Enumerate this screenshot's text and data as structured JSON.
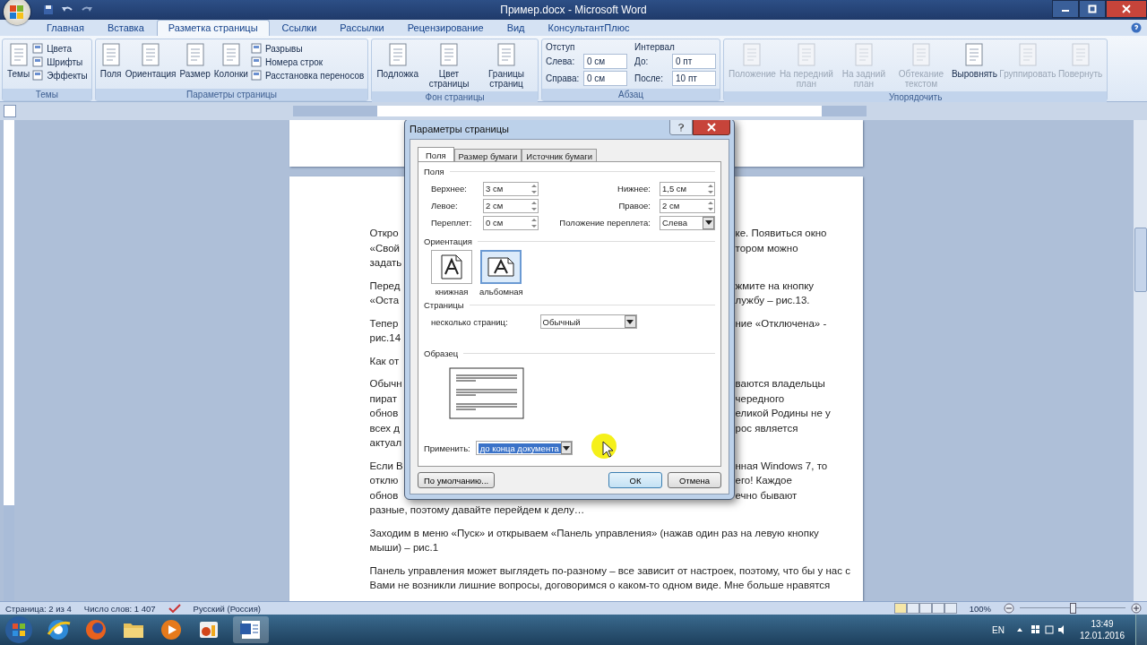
{
  "window": {
    "title": "Пример.docx - Microsoft Word"
  },
  "tabs": [
    {
      "label": "Главная",
      "selected": false
    },
    {
      "label": "Вставка",
      "selected": false
    },
    {
      "label": "Разметка страницы",
      "selected": true
    },
    {
      "label": "Ссылки",
      "selected": false
    },
    {
      "label": "Рассылки",
      "selected": false
    },
    {
      "label": "Рецензирование",
      "selected": false
    },
    {
      "label": "Вид",
      "selected": false
    },
    {
      "label": "КонсультантПлюс",
      "selected": false
    }
  ],
  "ribbon": [
    {
      "title": "Темы",
      "items": [
        {
          "kind": "big",
          "label": "Темы",
          "disabled": false
        },
        {
          "kind": "small",
          "label": "Цвета"
        },
        {
          "kind": "small",
          "label": "Шрифты"
        },
        {
          "kind": "small",
          "label": "Эффекты"
        }
      ]
    },
    {
      "title": "Параметры страницы",
      "items": [
        {
          "kind": "big",
          "label": "Поля",
          "disabled": false
        },
        {
          "kind": "big",
          "label": "Ориентация",
          "disabled": false
        },
        {
          "kind": "big",
          "label": "Размер",
          "disabled": false
        },
        {
          "kind": "big",
          "label": "Колонки",
          "disabled": false
        },
        {
          "kind": "small",
          "label": "Разрывы"
        },
        {
          "kind": "small",
          "label": "Номера строк"
        },
        {
          "kind": "small",
          "label": "Расстановка переносов"
        }
      ]
    },
    {
      "title": "Фон страницы",
      "items": [
        {
          "kind": "big",
          "label": "Подложка",
          "disabled": false
        },
        {
          "kind": "big",
          "label": "Цвет страницы",
          "disabled": false
        },
        {
          "kind": "big",
          "label": "Границы страниц",
          "disabled": false
        }
      ]
    },
    {
      "title": "Абзац",
      "items": [
        {
          "kind": "heading",
          "label": "Отступ"
        },
        {
          "kind": "spin",
          "label": "Слева:",
          "value": "0 см"
        },
        {
          "kind": "spin",
          "label": "Справа:",
          "value": "0 см"
        },
        {
          "kind": "heading",
          "label": "Интервал"
        },
        {
          "kind": "spin",
          "label": "До:",
          "value": "0 пт"
        },
        {
          "kind": "spin",
          "label": "После:",
          "value": "10 пт"
        }
      ]
    },
    {
      "title": "Упорядочить",
      "items": [
        {
          "kind": "big",
          "label": "Положение",
          "disabled": true
        },
        {
          "kind": "big",
          "label": "На передний план",
          "disabled": true
        },
        {
          "kind": "big",
          "label": "На задний план",
          "disabled": true
        },
        {
          "kind": "big",
          "label": "Обтекание текстом",
          "disabled": true
        },
        {
          "kind": "big",
          "label": "Выровнять",
          "disabled": false
        },
        {
          "kind": "big",
          "label": "Группировать",
          "disabled": true
        },
        {
          "kind": "big",
          "label": "Повернуть",
          "disabled": true
        }
      ]
    }
  ],
  "document": {
    "paragraphs": [
      {
        "lines": [
          {
            "kind": "split",
            "left": "Откро",
            "right": "ке. Появиться окно"
          },
          {
            "kind": "split",
            "left": "«Свой",
            "right": "тором можно"
          },
          {
            "kind": "split",
            "left": "задать"
          }
        ]
      },
      {
        "lines": [
          {
            "kind": "split",
            "left": "Перед",
            "right": "жмите на кнопку"
          },
          {
            "kind": "split",
            "left": "«Оста",
            "right": "лужбу – рис.13."
          }
        ]
      },
      {
        "lines": [
          {
            "kind": "split",
            "left": "Тепер",
            "right": "ние «Отключена» -"
          },
          {
            "kind": "split",
            "left": "рис.14"
          }
        ]
      },
      {
        "lines": [
          {
            "kind": "split",
            "left": "Как от"
          }
        ]
      },
      {
        "lines": [
          {
            "kind": "split",
            "left": "Обычн",
            "right": "ваются владельцы"
          },
          {
            "kind": "split",
            "left": "пират",
            "right": "чередного"
          },
          {
            "kind": "split",
            "left": "обнов",
            "right": "еликой Родины не у"
          },
          {
            "kind": "split",
            "left": "всех д",
            "right": "рос является"
          },
          {
            "kind": "split",
            "left": "актуал"
          }
        ]
      },
      {
        "lines": [
          {
            "kind": "split",
            "left": "Если В",
            "right": "нная Windows 7, то"
          },
          {
            "kind": "split",
            "left": "отклю",
            "right": "его! Каждое"
          },
          {
            "kind": "split",
            "left": "обнов",
            "right": "ечно бывают"
          },
          {
            "kind": "full",
            "text": "разные, поэтому давайте перейдем к делу…"
          }
        ]
      },
      {
        "lines": [
          {
            "kind": "full",
            "text": "Заходим в меню «Пуск» и открываем «Панель управления» (нажав один раз на левую кнопку"
          },
          {
            "kind": "full",
            "text": "мыши) – рис.1"
          }
        ]
      },
      {
        "lines": [
          {
            "kind": "full",
            "text": "Панель управления может выглядеть по-разному – все зависит от настроек, поэтому, что бы у нас с"
          },
          {
            "kind": "full",
            "text": "Вами не возникли лишние вопросы, договоримся о каком-то одном виде. Мне больше нравятся"
          }
        ]
      }
    ]
  },
  "dialog": {
    "title": "Параметры страницы",
    "tabs": [
      {
        "label": "Поля",
        "selected": true
      },
      {
        "label": "Размер бумаги",
        "selected": false
      },
      {
        "label": "Источник бумаги",
        "selected": false
      }
    ],
    "margins_title": "Поля",
    "margins": [
      {
        "label": "Верхнее:",
        "value": "3 см"
      },
      {
        "label": "Нижнее:",
        "value": "1,5 см"
      },
      {
        "label": "Левое:",
        "value": "2 см"
      },
      {
        "label": "Правое:",
        "value": "2 см"
      },
      {
        "label": "Переплет:",
        "value": "0 см"
      }
    ],
    "gutter": {
      "label": "Положение переплета:",
      "value": "Слева"
    },
    "orientation_title": "Ориентация",
    "orientations": [
      {
        "label": "книжная",
        "kind": "portrait",
        "selected": false
      },
      {
        "label": "альбомная",
        "kind": "landscape",
        "selected": true
      }
    ],
    "pages_title": "Страницы",
    "pages": {
      "label": "несколько страниц:",
      "value": "Обычный"
    },
    "preview_title": "Образец",
    "apply": {
      "label": "Применить:",
      "value": "до конца документа"
    },
    "buttons": [
      {
        "label": "По умолчанию...",
        "kind": "left"
      },
      {
        "label": "ОК",
        "kind": "default"
      },
      {
        "label": "Отмена",
        "kind": "normal"
      }
    ]
  },
  "status_bar": {
    "page": "Страница: 2 из 4",
    "words": "Число слов: 1 407",
    "language": "Русский (Россия)",
    "zoom": "100%",
    "zoom_slider": {
      "level": 0.5
    }
  },
  "taskbar": {
    "language": "EN",
    "time": "13:49",
    "date": "12.01.2016"
  }
}
